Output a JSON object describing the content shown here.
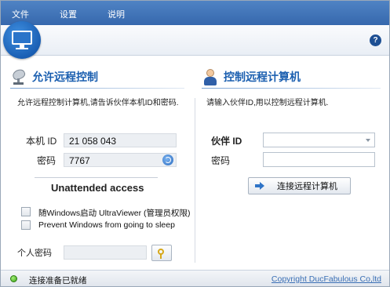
{
  "menu": {
    "file": "文件",
    "settings": "设置",
    "help": "说明"
  },
  "toolbar": {
    "help_glyph": "?"
  },
  "allow": {
    "title": "允许远程控制",
    "description": "允许远程控制计算机,请告诉伙伴本机ID和密码.",
    "id_label": "本机 ID",
    "id_value": "21 058 043",
    "password_label": "密码",
    "password_value": "7767",
    "unattended_title": "Unattended access",
    "option1_label": "随Windows启动 UltraViewer (管理员权限)",
    "option2_label": "Prevent Windows from going to sleep",
    "personal_password_label": "个人密码"
  },
  "control": {
    "title": "控制远程计算机",
    "description": "请输入伙伴ID,用以控制远程计算机.",
    "partner_id_label": "伙伴 ID",
    "password_label": "密码",
    "connect_button": "连接远程计算机"
  },
  "status": {
    "text": "连接准备已就绪",
    "copyright": "Copyright DucFabulous Co,ltd",
    "indicator_color": "#3aa317"
  },
  "colors": {
    "menubar": "#3f74b8",
    "accent": "#1b5fb0"
  }
}
